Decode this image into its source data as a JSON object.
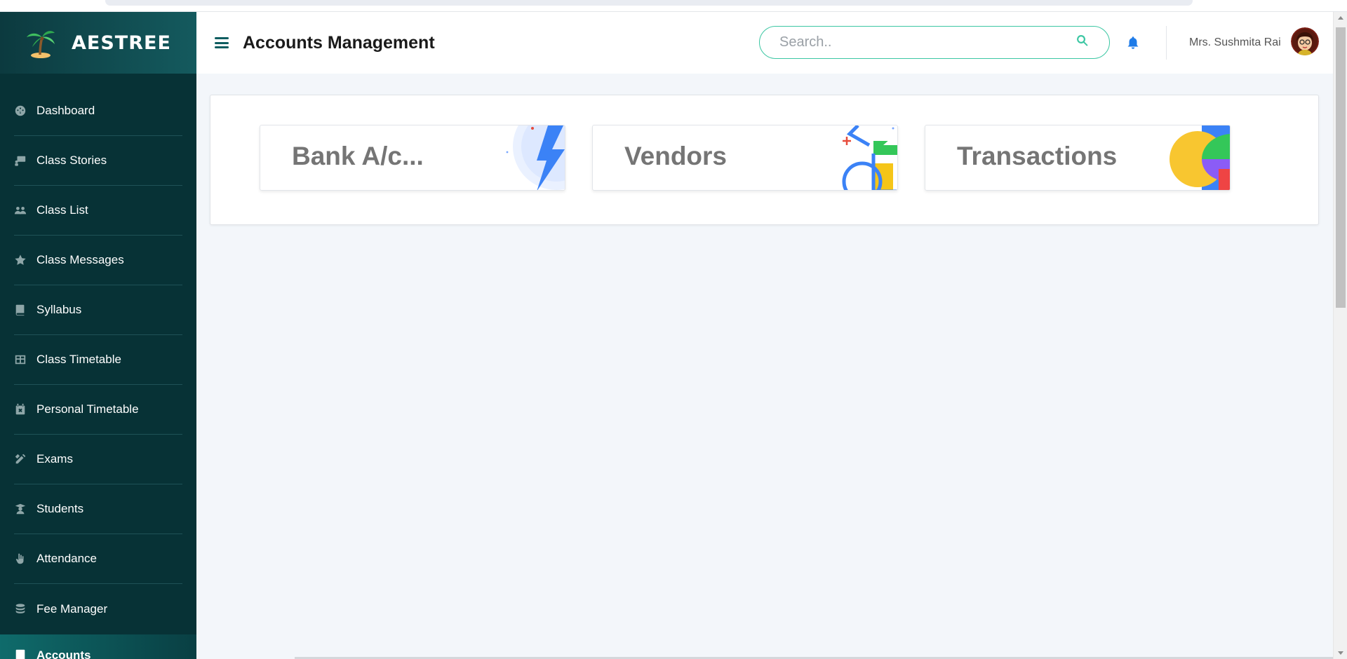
{
  "brand": {
    "name": "AESTREE"
  },
  "sidebar": {
    "items": [
      {
        "label": "Dashboard",
        "icon": "dashboard-icon"
      },
      {
        "label": "Class Stories",
        "icon": "chalkboard-icon"
      },
      {
        "label": "Class List",
        "icon": "users-icon"
      },
      {
        "label": "Class Messages",
        "icon": "star-icon"
      },
      {
        "label": "Syllabus",
        "icon": "book-icon"
      },
      {
        "label": "Class Timetable",
        "icon": "table-icon"
      },
      {
        "label": "Personal Timetable",
        "icon": "calendar-icon"
      },
      {
        "label": "Exams",
        "icon": "pencil-ruler-icon"
      },
      {
        "label": "Students",
        "icon": "student-icon"
      },
      {
        "label": "Attendance",
        "icon": "hand-icon"
      },
      {
        "label": "Fee Manager",
        "icon": "coins-icon"
      }
    ],
    "peek_item": {
      "label": "Accounts",
      "icon": "ledger-icon"
    }
  },
  "header": {
    "title": "Accounts Management",
    "search_placeholder": "Search..",
    "user_name": "Mrs. Sushmita Rai"
  },
  "tiles": [
    {
      "label": "Bank A/c..."
    },
    {
      "label": "Vendors"
    },
    {
      "label": "Transactions"
    }
  ],
  "colors": {
    "sidebar_bg": "#073236",
    "accent_teal": "#3cc7a3",
    "bell_blue": "#1e7be8",
    "tile_text": "#757575"
  }
}
